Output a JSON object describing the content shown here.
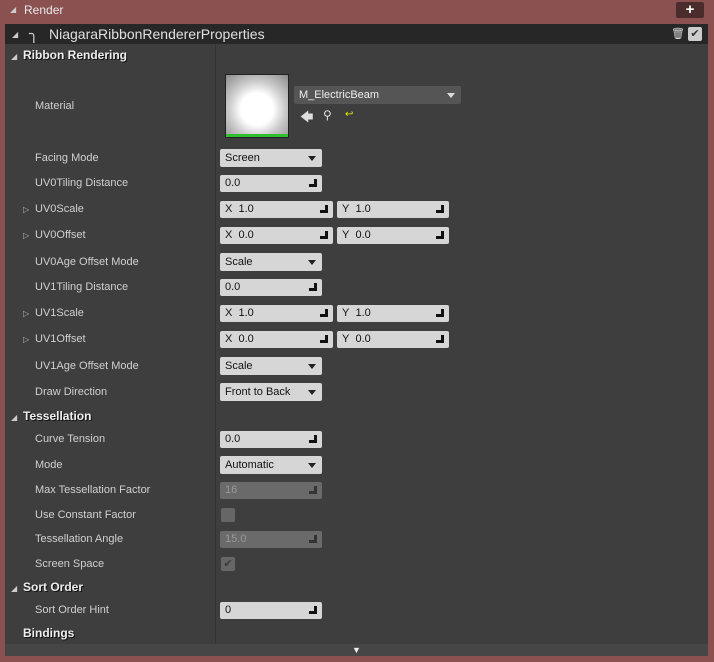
{
  "render": {
    "title": "Render",
    "add": "+"
  },
  "panel": {
    "title": "NiagaraRibbonRendererProperties"
  },
  "ribbon": {
    "title": "Ribbon Rendering",
    "material_label": "Material",
    "material_value": "M_ElectricBeam",
    "facing_label": "Facing Mode",
    "facing_value": "Screen",
    "uv0tiling_label": "UV0Tiling Distance",
    "uv0tiling_value": "0.0",
    "uv0scale_label": "UV0Scale",
    "uv0scale_x": "1.0",
    "uv0scale_y": "1.0",
    "uv0offset_label": "UV0Offset",
    "uv0offset_x": "0.0",
    "uv0offset_y": "0.0",
    "uv0age_label": "UV0Age Offset Mode",
    "uv0age_value": "Scale",
    "uv1tiling_label": "UV1Tiling Distance",
    "uv1tiling_value": "0.0",
    "uv1scale_label": "UV1Scale",
    "uv1scale_x": "1.0",
    "uv1scale_y": "1.0",
    "uv1offset_label": "UV1Offset",
    "uv1offset_x": "0.0",
    "uv1offset_y": "0.0",
    "uv1age_label": "UV1Age Offset Mode",
    "uv1age_value": "Scale",
    "draw_label": "Draw Direction",
    "draw_value": "Front to Back"
  },
  "axis": {
    "x": "X",
    "y": "Y"
  },
  "tess": {
    "title": "Tessellation",
    "curve_label": "Curve Tension",
    "curve_value": "0.0",
    "mode_label": "Mode",
    "mode_value": "Automatic",
    "max_label": "Max Tessellation Factor",
    "max_value": "16",
    "const_label": "Use Constant Factor",
    "angle_label": "Tessellation Angle",
    "angle_value": "15.0",
    "screen_label": "Screen Space"
  },
  "sort": {
    "title": "Sort Order",
    "hint_label": "Sort Order Hint",
    "hint_value": "0"
  },
  "bindings": {
    "title": "Bindings"
  }
}
